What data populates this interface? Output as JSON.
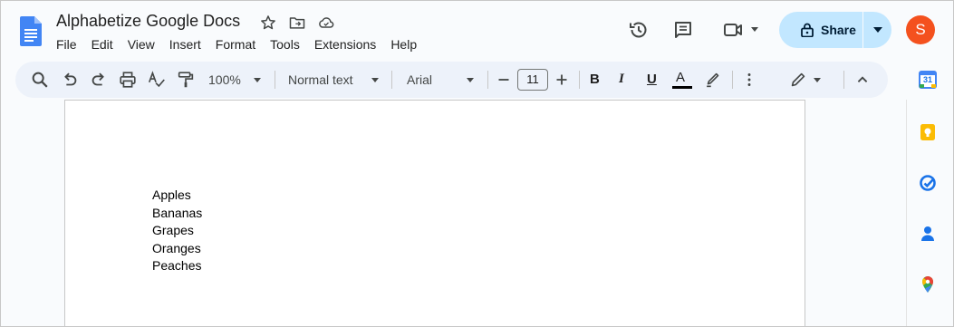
{
  "document": {
    "title": "Alphabetize Google Docs",
    "lines": [
      "Apples",
      "Bananas",
      "Grapes",
      "Oranges",
      "Peaches"
    ]
  },
  "menu": [
    "File",
    "Edit",
    "View",
    "Insert",
    "Format",
    "Tools",
    "Extensions",
    "Help"
  ],
  "share": {
    "label": "Share"
  },
  "user": {
    "avatar_letter": "S"
  },
  "toolbar": {
    "zoom": "100%",
    "style": "Normal text",
    "font": "Arial",
    "font_size": "11",
    "bold_glyph": "B",
    "italic_glyph": "I",
    "underline_glyph": "U",
    "text_color_glyph": "A"
  },
  "calendar": {
    "day": "31"
  },
  "colors": {
    "share_bg": "#c2e7ff",
    "avatar": "#f4511e",
    "docs_blue": "#4285f4",
    "toolbar_bg": "#edf2fa"
  },
  "icons": {
    "header": [
      "star-icon",
      "move-to-folder-icon",
      "cloud-saved-icon",
      "version-history-icon",
      "comments-icon",
      "meet-icon"
    ],
    "side": [
      "calendar-icon",
      "keep-icon",
      "tasks-icon",
      "contacts-icon",
      "maps-icon"
    ]
  }
}
